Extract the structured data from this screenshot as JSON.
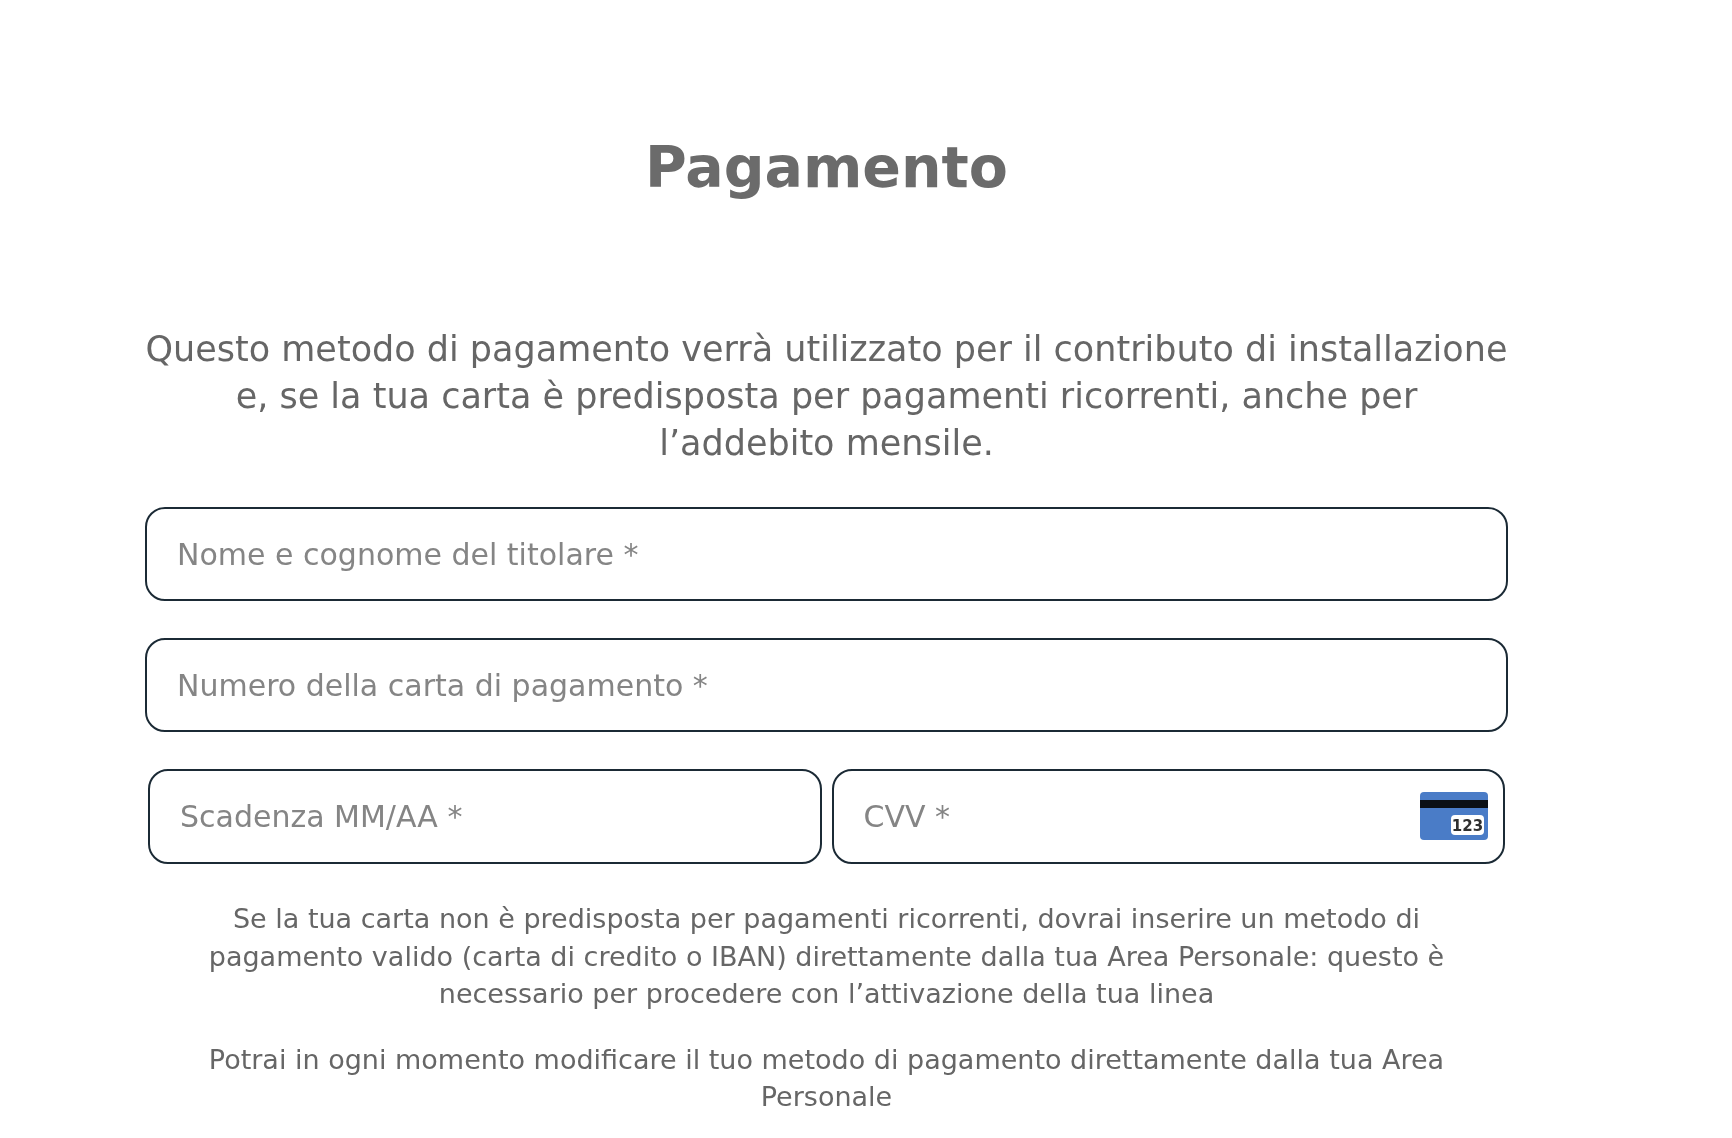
{
  "title": "Pagamento",
  "intro": "Questo metodo di pagamento verrà utilizzato per il contributo di installazione e, se la tua carta è predisposta per pagamenti ricorrenti, anche per l’addebito mensile.",
  "form": {
    "rows": [
      {
        "fields": [
          {
            "kind": "text",
            "placeholder": "Nome e cognome del titolare *"
          }
        ]
      },
      {
        "fields": [
          {
            "kind": "text",
            "placeholder": "Numero della carta di pagamento *"
          }
        ]
      },
      {
        "fields": [
          {
            "kind": "text",
            "placeholder": "Scadenza MM/AA *"
          },
          {
            "kind": "card_code",
            "placeholder": "CVV *",
            "icon_label": "123"
          }
        ]
      }
    ]
  },
  "notes": [
    "Se la tua carta non è predisposta per pagamenti ricorrenti, dovrai inserire un metodo di pagamento valido (carta di credito o IBAN) direttamente dalla tua Area Personale: questo è necessario per procedere con l’attivazione della tua linea",
    "Potrai in ogni momento modificare il tuo metodo di pagamento direttamente dalla tua Area Personale"
  ]
}
